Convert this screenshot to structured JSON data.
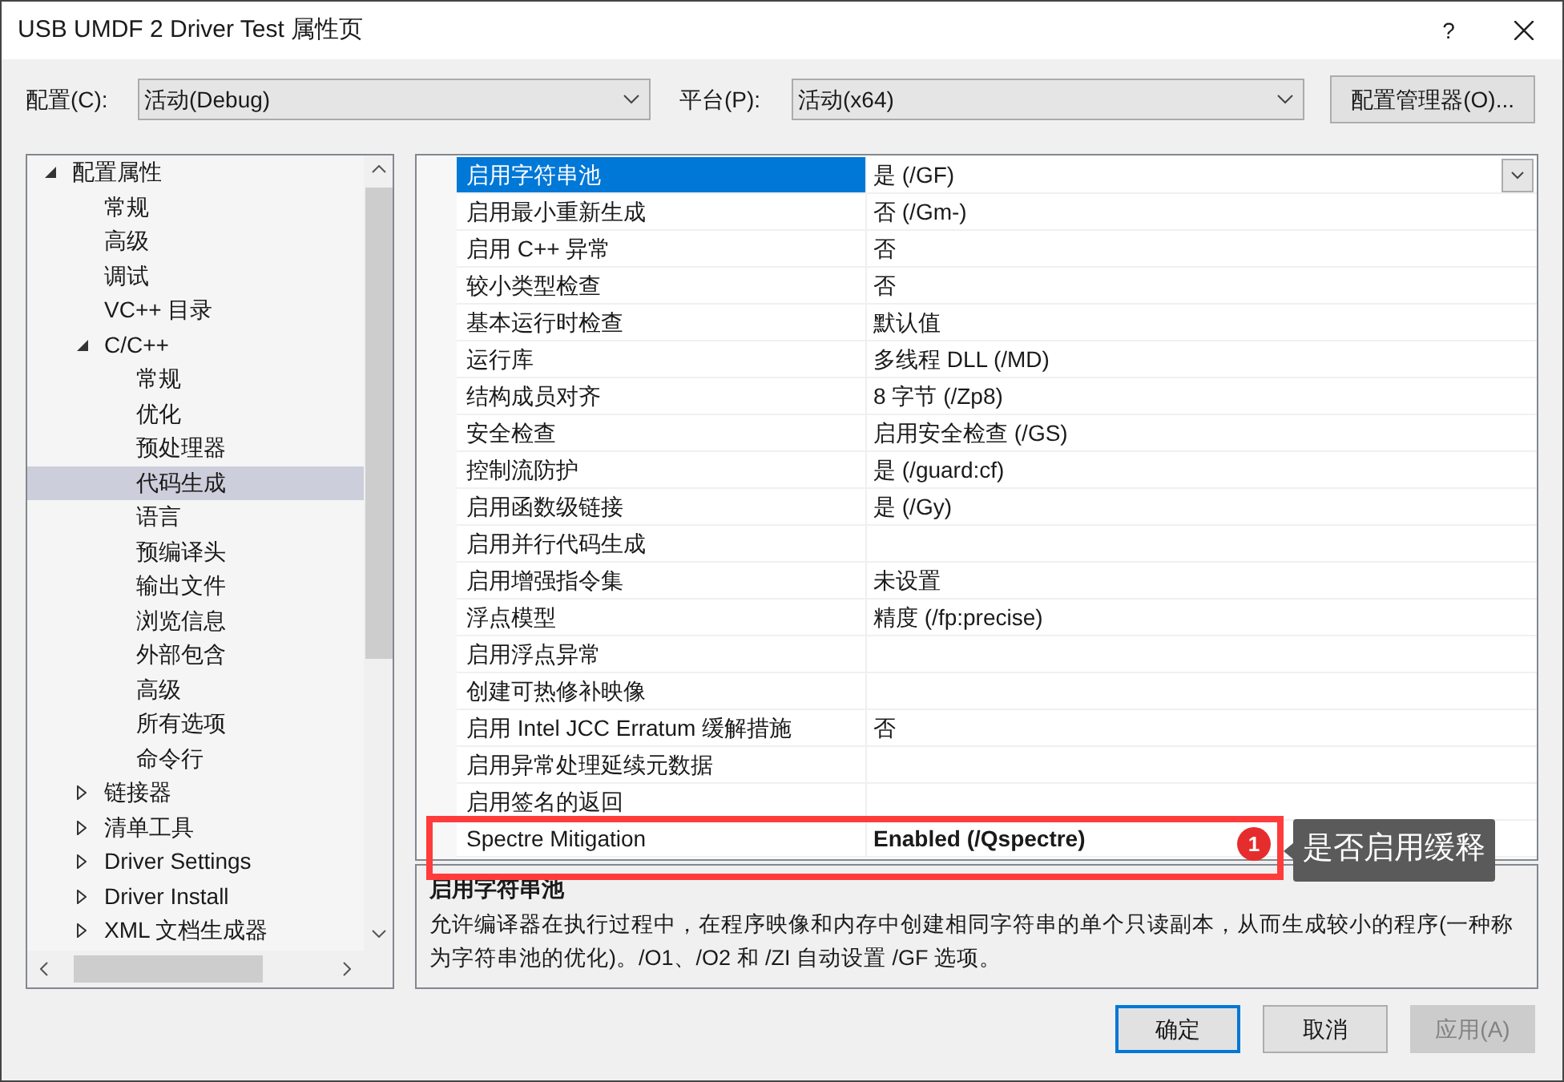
{
  "window": {
    "title": "USB UMDF 2 Driver Test 属性页",
    "help": "?"
  },
  "config": {
    "label": "配置(C):",
    "value": "活动(Debug)"
  },
  "platform": {
    "label": "平台(P):",
    "value": "活动(x64)"
  },
  "config_manager_button": "配置管理器(O)...",
  "tree": [
    {
      "label": "配置属性",
      "expanded": true,
      "selected": false,
      "children": [
        {
          "label": "常规",
          "selected": false
        },
        {
          "label": "高级",
          "selected": false
        },
        {
          "label": "调试",
          "selected": false
        },
        {
          "label": "VC++ 目录",
          "selected": false
        },
        {
          "label": "C/C++",
          "expanded": true,
          "selected": false,
          "children": [
            {
              "label": "常规",
              "selected": false
            },
            {
              "label": "优化",
              "selected": false
            },
            {
              "label": "预处理器",
              "selected": false
            },
            {
              "label": "代码生成",
              "selected": true
            },
            {
              "label": "语言",
              "selected": false
            },
            {
              "label": "预编译头",
              "selected": false
            },
            {
              "label": "输出文件",
              "selected": false
            },
            {
              "label": "浏览信息",
              "selected": false
            },
            {
              "label": "外部包含",
              "selected": false
            },
            {
              "label": "高级",
              "selected": false
            },
            {
              "label": "所有选项",
              "selected": false
            },
            {
              "label": "命令行",
              "selected": false
            }
          ]
        },
        {
          "label": "链接器",
          "expanded": false,
          "selected": false
        },
        {
          "label": "清单工具",
          "expanded": false,
          "selected": false
        },
        {
          "label": "Driver Settings",
          "expanded": false,
          "selected": false
        },
        {
          "label": "Driver Install",
          "expanded": false,
          "selected": false
        },
        {
          "label": "XML 文档生成器",
          "expanded": false,
          "selected": false
        }
      ]
    }
  ],
  "properties": [
    {
      "name": "启用字符串池",
      "value": "是 (/GF)",
      "selected": true,
      "modified": false
    },
    {
      "name": "启用最小重新生成",
      "value": "否 (/Gm-)",
      "selected": false,
      "modified": false
    },
    {
      "name": "启用 C++ 异常",
      "value": "否",
      "selected": false,
      "modified": false
    },
    {
      "name": "较小类型检查",
      "value": "否",
      "selected": false,
      "modified": false
    },
    {
      "name": "基本运行时检查",
      "value": "默认值",
      "selected": false,
      "modified": false
    },
    {
      "name": "运行库",
      "value": "多线程 DLL (/MD)",
      "selected": false,
      "modified": false
    },
    {
      "name": "结构成员对齐",
      "value": "8 字节 (/Zp8)",
      "selected": false,
      "modified": false
    },
    {
      "name": "安全检查",
      "value": "启用安全检查 (/GS)",
      "selected": false,
      "modified": false
    },
    {
      "name": "控制流防护",
      "value": "是 (/guard:cf)",
      "selected": false,
      "modified": false
    },
    {
      "name": "启用函数级链接",
      "value": "是 (/Gy)",
      "selected": false,
      "modified": false
    },
    {
      "name": "启用并行代码生成",
      "selected": false
    },
    {
      "name": "启用增强指令集",
      "value": "未设置",
      "selected": false,
      "modified": false
    },
    {
      "name": "浮点模型",
      "value": "精度 (/fp:precise)",
      "selected": false,
      "modified": false
    },
    {
      "name": "启用浮点异常",
      "selected": false
    },
    {
      "name": "创建可热修补映像",
      "selected": false
    },
    {
      "name": "启用 Intel JCC Erratum 缓解措施",
      "value": "否",
      "selected": false,
      "modified": false
    },
    {
      "name": "启用异常处理延续元数据",
      "selected": false
    },
    {
      "name": "启用签名的返回",
      "selected": false
    },
    {
      "name": "Spectre Mitigation",
      "value": "Enabled (/Qspectre)",
      "selected": false,
      "modified": true
    }
  ],
  "description": {
    "title": "启用字符串池",
    "text": "允许编译器在执行过程中，在程序映像和内存中创建相同字符串的单个只读副本，从而生成较小的程序(一种称为字符串池的优化)。/O1、/O2 和 /ZI 自动设置 /GF 选项。"
  },
  "annotation": {
    "number": "1",
    "note": "是否启用缓释"
  },
  "buttons": [
    {
      "label": "确定",
      "kind": "default",
      "disabled": false
    },
    {
      "label": "取消",
      "kind": "normal",
      "disabled": false
    },
    {
      "label": "应用(A)",
      "kind": "normal",
      "disabled": true
    }
  ]
}
